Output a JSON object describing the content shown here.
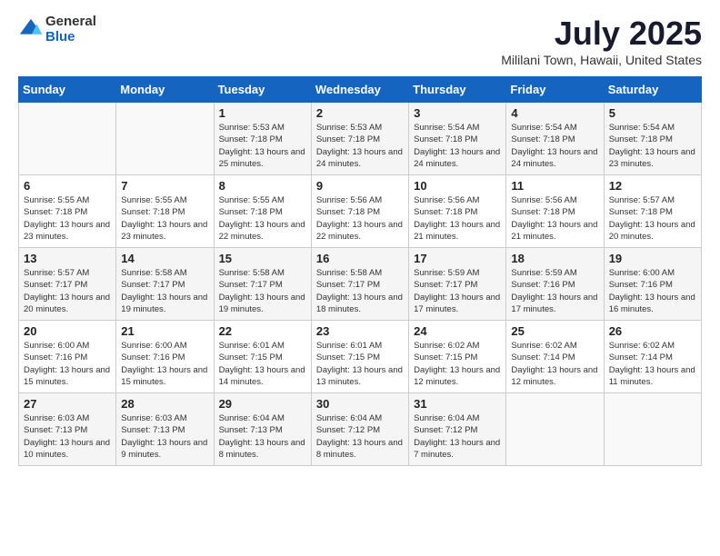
{
  "header": {
    "logo_general": "General",
    "logo_blue": "Blue",
    "month_title": "July 2025",
    "location": "Mililani Town, Hawaii, United States"
  },
  "days_of_week": [
    "Sunday",
    "Monday",
    "Tuesday",
    "Wednesday",
    "Thursday",
    "Friday",
    "Saturday"
  ],
  "weeks": [
    [
      {
        "day": "",
        "info": ""
      },
      {
        "day": "",
        "info": ""
      },
      {
        "day": "1",
        "info": "Sunrise: 5:53 AM\nSunset: 7:18 PM\nDaylight: 13 hours and 25 minutes."
      },
      {
        "day": "2",
        "info": "Sunrise: 5:53 AM\nSunset: 7:18 PM\nDaylight: 13 hours and 24 minutes."
      },
      {
        "day": "3",
        "info": "Sunrise: 5:54 AM\nSunset: 7:18 PM\nDaylight: 13 hours and 24 minutes."
      },
      {
        "day": "4",
        "info": "Sunrise: 5:54 AM\nSunset: 7:18 PM\nDaylight: 13 hours and 24 minutes."
      },
      {
        "day": "5",
        "info": "Sunrise: 5:54 AM\nSunset: 7:18 PM\nDaylight: 13 hours and 23 minutes."
      }
    ],
    [
      {
        "day": "6",
        "info": "Sunrise: 5:55 AM\nSunset: 7:18 PM\nDaylight: 13 hours and 23 minutes."
      },
      {
        "day": "7",
        "info": "Sunrise: 5:55 AM\nSunset: 7:18 PM\nDaylight: 13 hours and 23 minutes."
      },
      {
        "day": "8",
        "info": "Sunrise: 5:55 AM\nSunset: 7:18 PM\nDaylight: 13 hours and 22 minutes."
      },
      {
        "day": "9",
        "info": "Sunrise: 5:56 AM\nSunset: 7:18 PM\nDaylight: 13 hours and 22 minutes."
      },
      {
        "day": "10",
        "info": "Sunrise: 5:56 AM\nSunset: 7:18 PM\nDaylight: 13 hours and 21 minutes."
      },
      {
        "day": "11",
        "info": "Sunrise: 5:56 AM\nSunset: 7:18 PM\nDaylight: 13 hours and 21 minutes."
      },
      {
        "day": "12",
        "info": "Sunrise: 5:57 AM\nSunset: 7:18 PM\nDaylight: 13 hours and 20 minutes."
      }
    ],
    [
      {
        "day": "13",
        "info": "Sunrise: 5:57 AM\nSunset: 7:17 PM\nDaylight: 13 hours and 20 minutes."
      },
      {
        "day": "14",
        "info": "Sunrise: 5:58 AM\nSunset: 7:17 PM\nDaylight: 13 hours and 19 minutes."
      },
      {
        "day": "15",
        "info": "Sunrise: 5:58 AM\nSunset: 7:17 PM\nDaylight: 13 hours and 19 minutes."
      },
      {
        "day": "16",
        "info": "Sunrise: 5:58 AM\nSunset: 7:17 PM\nDaylight: 13 hours and 18 minutes."
      },
      {
        "day": "17",
        "info": "Sunrise: 5:59 AM\nSunset: 7:17 PM\nDaylight: 13 hours and 17 minutes."
      },
      {
        "day": "18",
        "info": "Sunrise: 5:59 AM\nSunset: 7:16 PM\nDaylight: 13 hours and 17 minutes."
      },
      {
        "day": "19",
        "info": "Sunrise: 6:00 AM\nSunset: 7:16 PM\nDaylight: 13 hours and 16 minutes."
      }
    ],
    [
      {
        "day": "20",
        "info": "Sunrise: 6:00 AM\nSunset: 7:16 PM\nDaylight: 13 hours and 15 minutes."
      },
      {
        "day": "21",
        "info": "Sunrise: 6:00 AM\nSunset: 7:16 PM\nDaylight: 13 hours and 15 minutes."
      },
      {
        "day": "22",
        "info": "Sunrise: 6:01 AM\nSunset: 7:15 PM\nDaylight: 13 hours and 14 minutes."
      },
      {
        "day": "23",
        "info": "Sunrise: 6:01 AM\nSunset: 7:15 PM\nDaylight: 13 hours and 13 minutes."
      },
      {
        "day": "24",
        "info": "Sunrise: 6:02 AM\nSunset: 7:15 PM\nDaylight: 13 hours and 12 minutes."
      },
      {
        "day": "25",
        "info": "Sunrise: 6:02 AM\nSunset: 7:14 PM\nDaylight: 13 hours and 12 minutes."
      },
      {
        "day": "26",
        "info": "Sunrise: 6:02 AM\nSunset: 7:14 PM\nDaylight: 13 hours and 11 minutes."
      }
    ],
    [
      {
        "day": "27",
        "info": "Sunrise: 6:03 AM\nSunset: 7:13 PM\nDaylight: 13 hours and 10 minutes."
      },
      {
        "day": "28",
        "info": "Sunrise: 6:03 AM\nSunset: 7:13 PM\nDaylight: 13 hours and 9 minutes."
      },
      {
        "day": "29",
        "info": "Sunrise: 6:04 AM\nSunset: 7:13 PM\nDaylight: 13 hours and 8 minutes."
      },
      {
        "day": "30",
        "info": "Sunrise: 6:04 AM\nSunset: 7:12 PM\nDaylight: 13 hours and 8 minutes."
      },
      {
        "day": "31",
        "info": "Sunrise: 6:04 AM\nSunset: 7:12 PM\nDaylight: 13 hours and 7 minutes."
      },
      {
        "day": "",
        "info": ""
      },
      {
        "day": "",
        "info": ""
      }
    ]
  ]
}
